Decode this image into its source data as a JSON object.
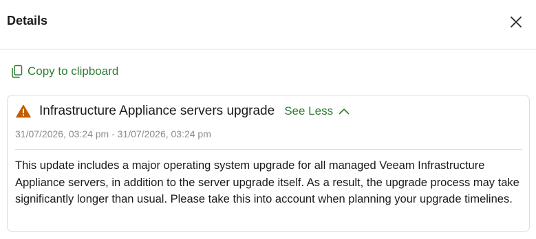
{
  "header": {
    "title": "Details",
    "close_icon": "close-icon"
  },
  "toolbar": {
    "copy_label": "Copy to clipboard",
    "copy_icon": "copy-icon"
  },
  "notification": {
    "severity_icon": "warning-icon",
    "severity_color": "#c25e00",
    "title": "Infrastructure Appliance servers upgrade",
    "toggle_label": "See Less",
    "toggle_icon": "chevron-up-icon",
    "timestamp": "31/07/2026, 03:24 pm - 31/07/2026, 03:24 pm",
    "body": "This update includes a major operating system upgrade for all managed Veeam Infrastructure Appliance servers, in addition to the server upgrade itself. As a result, the upgrade process may take significantly longer than usual. Please take this into account when planning your upgrade timelines."
  },
  "colors": {
    "accent": "#2e7d32",
    "muted_text": "#8a8a8a",
    "border": "#dcdcdc"
  }
}
